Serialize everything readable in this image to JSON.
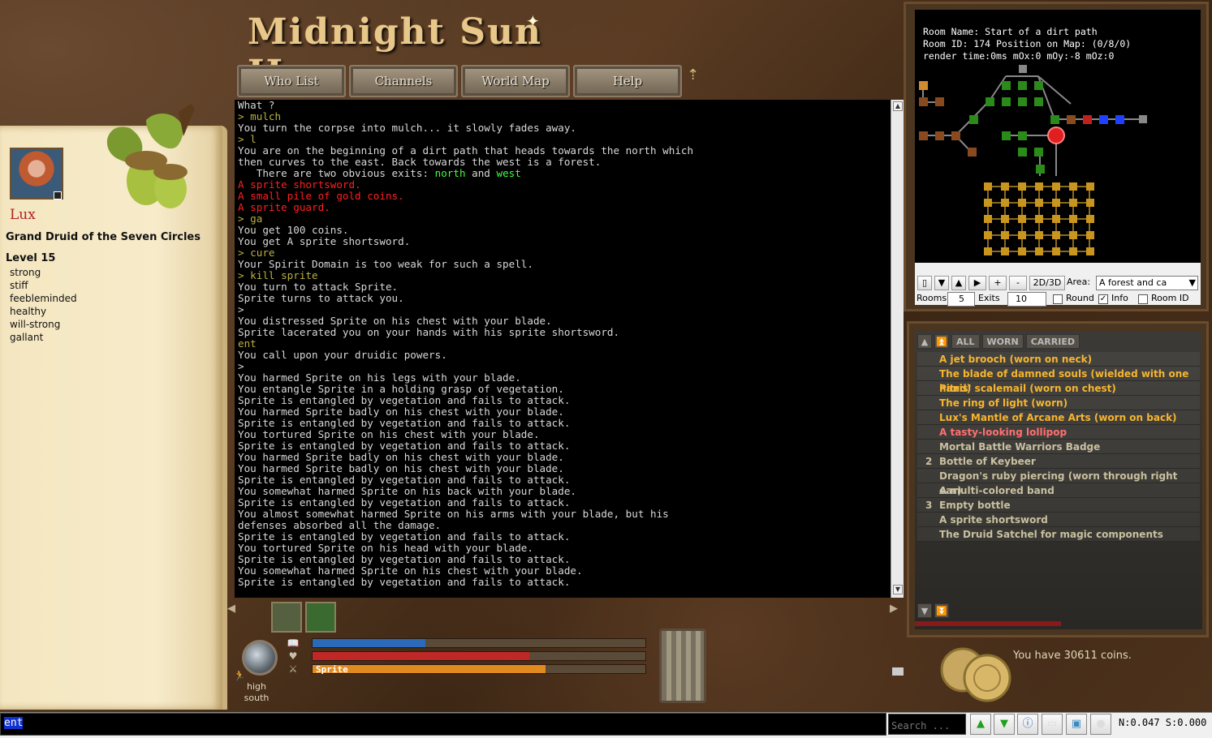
{
  "app": {
    "title": "Midnight Sun II"
  },
  "nav": {
    "items": [
      "Who List",
      "Channels",
      "World Map",
      "Help"
    ]
  },
  "character": {
    "name": "Lux",
    "title": "Grand Druid of the Seven Circles",
    "level": "Level 15",
    "traits": [
      "strong",
      "stiff",
      "feebleminded",
      "healthy",
      "will-strong",
      "gallant"
    ]
  },
  "terminal": {
    "lines": [
      {
        "t": "What ?",
        "c": "w"
      },
      {
        "t": "> mulch",
        "c": "cmd"
      },
      {
        "t": "You turn the corpse into mulch... it slowly fades away.",
        "c": "w"
      },
      {
        "t": "> l",
        "c": "cmd"
      },
      {
        "t": "You are on the beginning of a dirt path that heads towards the north which",
        "c": "w"
      },
      {
        "t": "then curves to the east. Back towards the west is a forest.",
        "c": "w"
      },
      {
        "t": "   There are two obvious exits: ",
        "c": "w",
        "exits": [
          "north",
          "west"
        ]
      },
      {
        "t": "A sprite shortsword.",
        "c": "red"
      },
      {
        "t": "A small pile of gold coins.",
        "c": "red"
      },
      {
        "t": "A sprite guard.",
        "c": "red"
      },
      {
        "t": "> ga",
        "c": "cmd"
      },
      {
        "t": "You get 100 coins.",
        "c": "w"
      },
      {
        "t": "You get A sprite shortsword.",
        "c": "w"
      },
      {
        "t": "> cure",
        "c": "cmd"
      },
      {
        "t": "Your Spirit Domain is too weak for such a spell.",
        "c": "w"
      },
      {
        "t": "> kill sprite",
        "c": "cmd"
      },
      {
        "t": "You turn to attack Sprite.",
        "c": "w"
      },
      {
        "t": "Sprite turns to attack you.",
        "c": "w"
      },
      {
        "t": ">",
        "c": "w"
      },
      {
        "t": "You distressed Sprite on his chest with your blade.",
        "c": "w"
      },
      {
        "t": "Sprite lacerated you on your hands with his sprite shortsword.",
        "c": "w"
      },
      {
        "t": "ent",
        "c": "cmd"
      },
      {
        "t": "You call upon your druidic powers.",
        "c": "w"
      },
      {
        "t": ">",
        "c": "w"
      },
      {
        "t": "You harmed Sprite on his legs with your blade.",
        "c": "w"
      },
      {
        "t": "You entangle Sprite in a holding grasp of vegetation.",
        "c": "w"
      },
      {
        "t": "Sprite is entangled by vegetation and fails to attack.",
        "c": "w"
      },
      {
        "t": "You harmed Sprite badly on his chest with your blade.",
        "c": "w"
      },
      {
        "t": "Sprite is entangled by vegetation and fails to attack.",
        "c": "w"
      },
      {
        "t": "You tortured Sprite on his chest with your blade.",
        "c": "w"
      },
      {
        "t": "Sprite is entangled by vegetation and fails to attack.",
        "c": "w"
      },
      {
        "t": "You harmed Sprite badly on his chest with your blade.",
        "c": "w"
      },
      {
        "t": "You harmed Sprite badly on his chest with your blade.",
        "c": "w"
      },
      {
        "t": "Sprite is entangled by vegetation and fails to attack.",
        "c": "w"
      },
      {
        "t": "You somewhat harmed Sprite on his back with your blade.",
        "c": "w"
      },
      {
        "t": "Sprite is entangled by vegetation and fails to attack.",
        "c": "w"
      },
      {
        "t": "You almost somewhat harmed Sprite on his arms with your blade, but his",
        "c": "w"
      },
      {
        "t": "defenses absorbed all the damage.",
        "c": "w"
      },
      {
        "t": "Sprite is entangled by vegetation and fails to attack.",
        "c": "w"
      },
      {
        "t": "You tortured Sprite on his head with your blade.",
        "c": "w"
      },
      {
        "t": "Sprite is entangled by vegetation and fails to attack.",
        "c": "w"
      },
      {
        "t": "You somewhat harmed Sprite on his chest with your blade.",
        "c": "w"
      },
      {
        "t": "Sprite is entangled by vegetation and fails to attack.",
        "c": "w"
      }
    ],
    "exit_and": " and "
  },
  "map": {
    "room_name": "Room Name: Start of a dirt path",
    "room_id": "Room ID: 174 Position on Map: (0/8/0)",
    "render": "render time:0ms mOx:0 mOy:-8 mOz:0",
    "btn_2d3d": "2D/3D",
    "area_label": "Area:",
    "area_value": "A forest and ca",
    "rooms_label": "Rooms",
    "rooms_value": "5",
    "exits_label": "Exits",
    "exits_value": "10",
    "round_label": "Round",
    "info_label": "Info",
    "roomid_label": "Room ID"
  },
  "inventory": {
    "tabs": [
      "ALL",
      "WORN",
      "CARRIED"
    ],
    "items": [
      {
        "q": "",
        "name": "A jet brooch (worn on neck)",
        "kind": "worn"
      },
      {
        "q": "",
        "name": "The blade of damned souls (wielded with one hand)",
        "kind": "worn"
      },
      {
        "q": "",
        "name": "Pitris' scalemail (worn on chest)",
        "kind": "worn"
      },
      {
        "q": "",
        "name": "The ring of light (worn)",
        "kind": "worn"
      },
      {
        "q": "",
        "name": "Lux's Mantle of Arcane Arts (worn on back)",
        "kind": "worn"
      },
      {
        "q": "",
        "name": "A tasty-looking lollipop",
        "kind": "hi"
      },
      {
        "q": "",
        "name": "Mortal Battle Warriors Badge",
        "kind": "norm"
      },
      {
        "q": "2",
        "name": "Bottle of Keybeer",
        "kind": "norm"
      },
      {
        "q": "",
        "name": "Dragon's ruby piercing (worn through right ear)",
        "kind": "norm"
      },
      {
        "q": "",
        "name": "A multi-colored band",
        "kind": "norm"
      },
      {
        "q": "3",
        "name": "Empty bottle",
        "kind": "norm"
      },
      {
        "q": "",
        "name": "A sprite shortsword",
        "kind": "norm"
      },
      {
        "q": "",
        "name": "The Druid Satchel for magic components",
        "kind": "norm"
      }
    ]
  },
  "coins": {
    "text": "You have 30611 coins."
  },
  "status": {
    "position_line1": "high",
    "position_line2": "south",
    "mana_fraction": 0.34,
    "health_fraction": 0.65,
    "target_label": "Sprite",
    "target_fraction": 0.7,
    "colors": {
      "mana": "#2a6ab8",
      "health": "#c02828",
      "target": "#e08a20"
    }
  },
  "input": {
    "value": "ent",
    "search_placeholder": "Search ..."
  },
  "stats": {
    "text": "N:0.047 S:0.000"
  },
  "icons": [
    "arrow-up-icon",
    "book-icon",
    "heart-icon",
    "crossed-swords-icon",
    "running-icon",
    "green-up-icon",
    "green-down-icon",
    "info-icon",
    "window-icon",
    "screen-icon",
    "bomb-icon"
  ]
}
